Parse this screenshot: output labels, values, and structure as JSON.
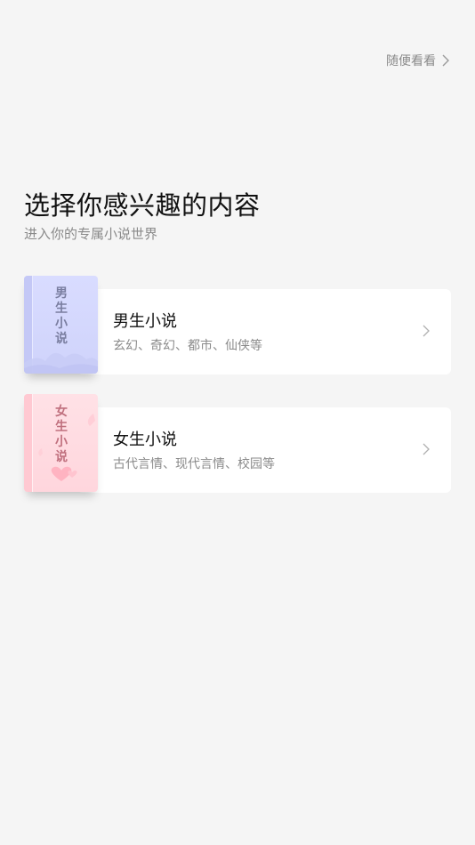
{
  "header": {
    "skip_label": "随便看看"
  },
  "intro": {
    "title": "选择你感兴趣的内容",
    "subtitle": "进入你的专属小说世界"
  },
  "options": [
    {
      "name": "男生小说",
      "desc": "玄幻、奇幻、都市、仙侠等",
      "cover_text": "男生小说",
      "accent": "#cfd3fb"
    },
    {
      "name": "女生小说",
      "desc": "古代言情、现代言情、校园等",
      "cover_text": "女生小说",
      "accent": "#ffd6dd"
    }
  ],
  "colors": {
    "background": "#f5f5f5",
    "card": "#ffffff",
    "muted_text": "#8a8a8a"
  }
}
